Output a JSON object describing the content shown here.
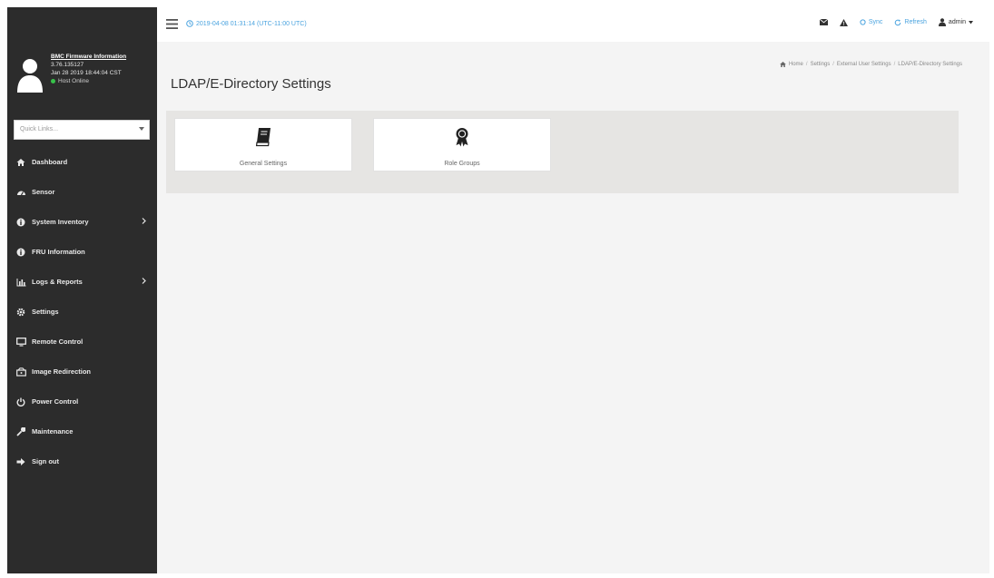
{
  "topbar": {
    "datetime": "2019-04-08 01:31:14 (UTC-11:00 UTC)",
    "sync_label": "Sync",
    "refresh_label": "Refresh",
    "user_label": "admin"
  },
  "profile": {
    "title": "BMC Firmware Information",
    "version": "3.76.135127",
    "timestamp": "Jan 28 2019 18:44:04 CST",
    "status": "Host Online"
  },
  "quick_links": {
    "placeholder": "Quick Links..."
  },
  "sidebar": {
    "items": [
      {
        "label": "Dashboard",
        "icon": "home-icon"
      },
      {
        "label": "Sensor",
        "icon": "dashboard-icon"
      },
      {
        "label": "System Inventory",
        "icon": "info-icon",
        "has_submenu": true
      },
      {
        "label": "FRU Information",
        "icon": "info-icon"
      },
      {
        "label": "Logs & Reports",
        "icon": "bar-chart-icon",
        "has_submenu": true
      },
      {
        "label": "Settings",
        "icon": "gear-icon"
      },
      {
        "label": "Remote Control",
        "icon": "monitor-icon"
      },
      {
        "label": "Image Redirection",
        "icon": "disc-icon"
      },
      {
        "label": "Power Control",
        "icon": "power-icon"
      },
      {
        "label": "Maintenance",
        "icon": "wrench-icon"
      },
      {
        "label": "Sign out",
        "icon": "sign-out-icon"
      }
    ]
  },
  "page": {
    "title": "LDAP/E-Directory Settings",
    "breadcrumb": [
      "Home",
      "Settings",
      "External User Settings",
      "LDAP/E-Directory Settings"
    ]
  },
  "cards": [
    {
      "label": "General Settings",
      "icon": "book-icon"
    },
    {
      "label": "Role Groups",
      "icon": "award-icon"
    }
  ]
}
